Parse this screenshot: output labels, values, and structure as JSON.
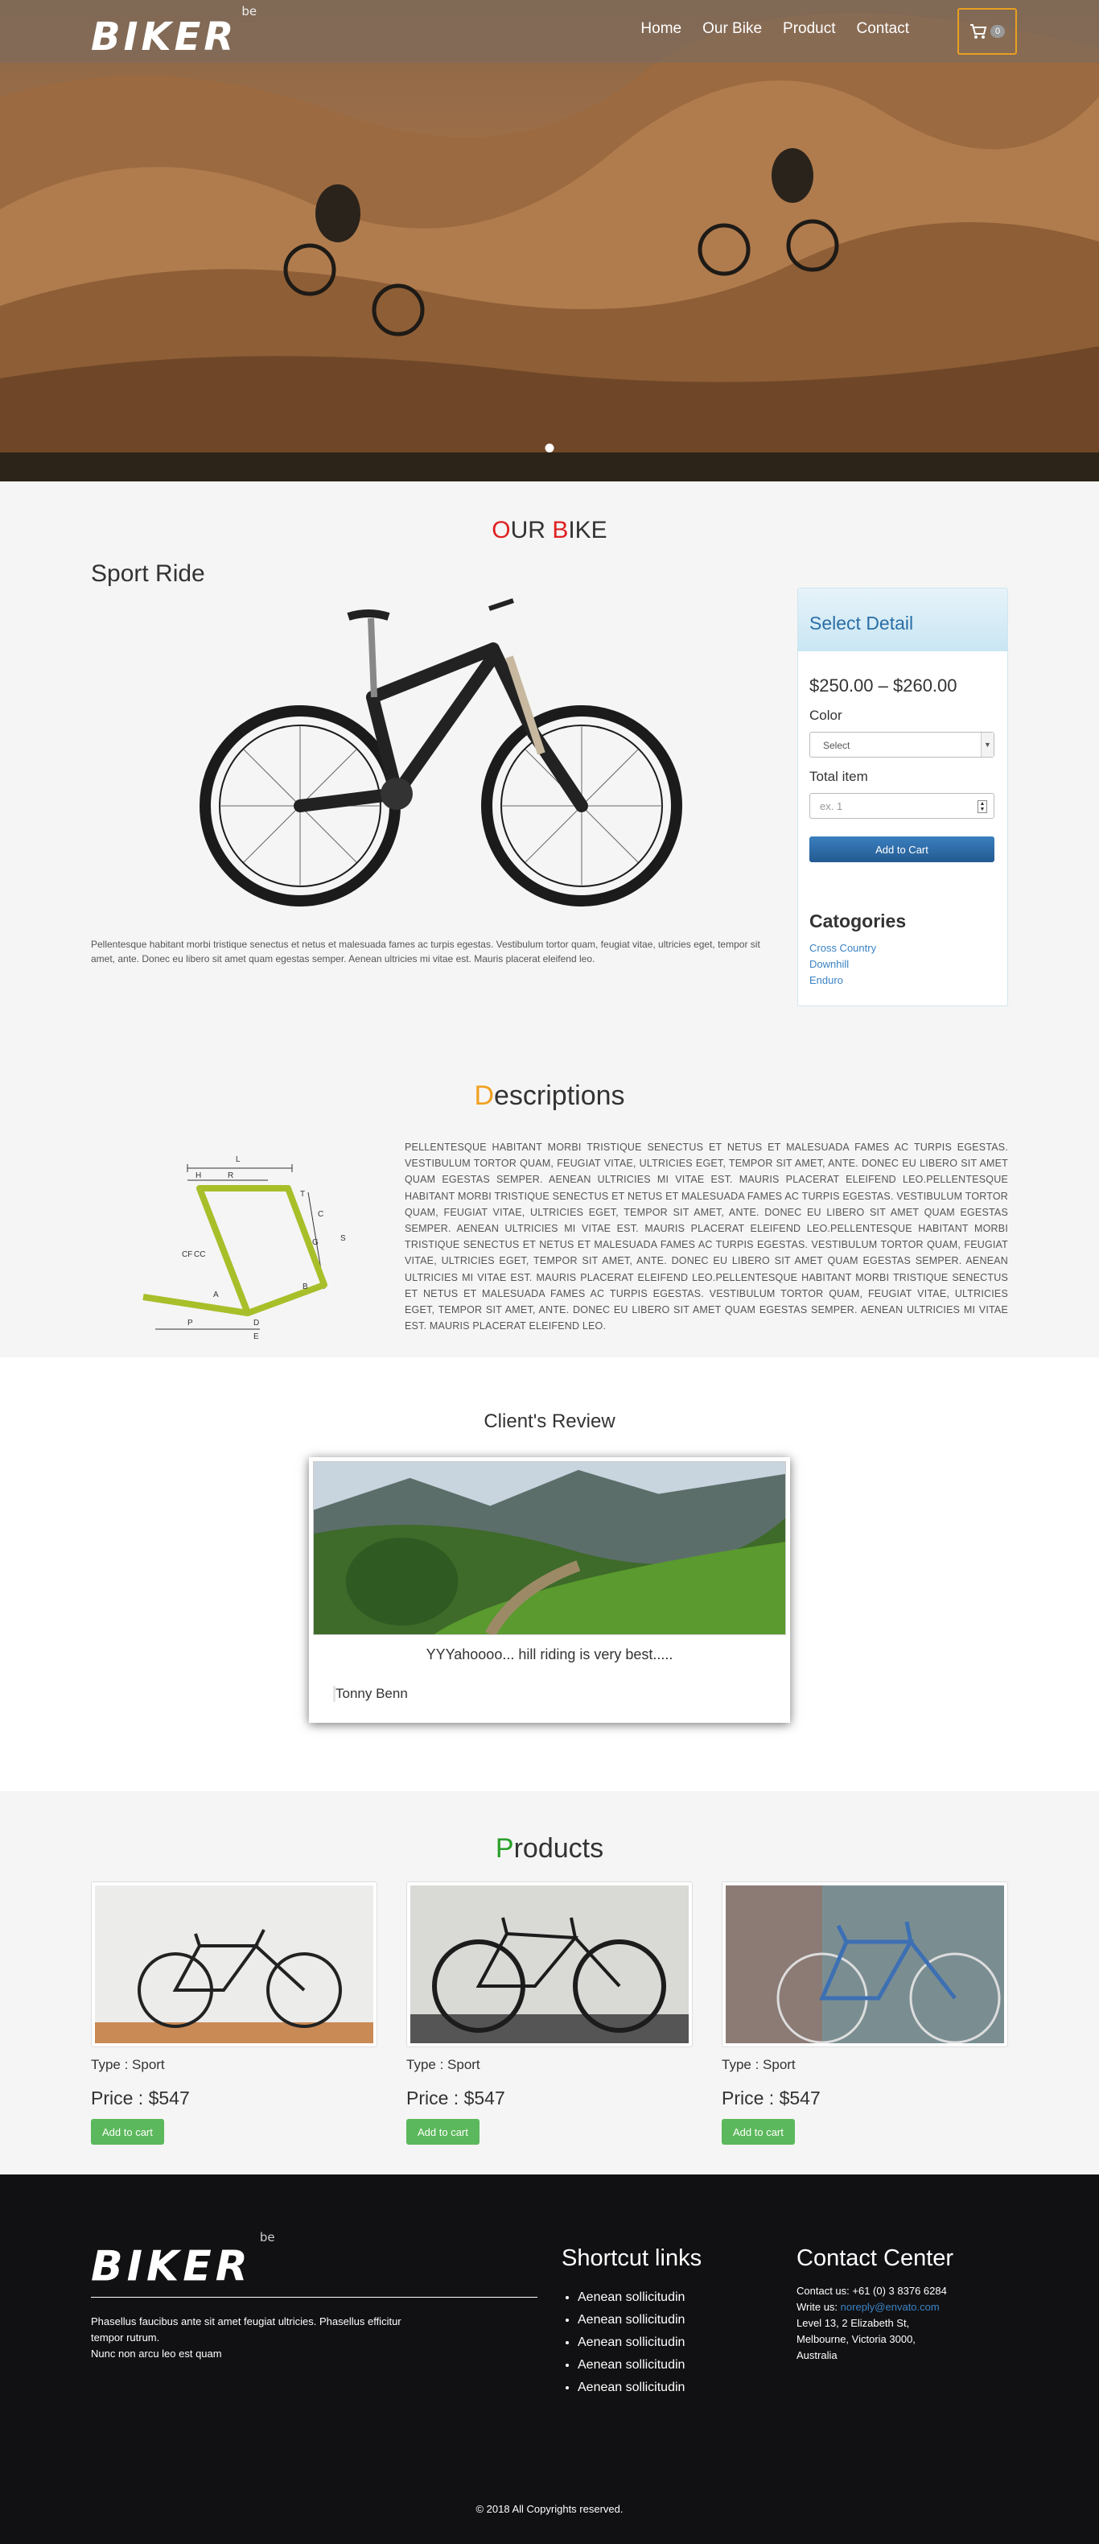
{
  "nav": {
    "logo": "BIKER",
    "logo_sup": "be",
    "links": [
      "Home",
      "Our Bike",
      "Product",
      "Contact"
    ],
    "cart_count": "0"
  },
  "our_bike": {
    "title_first": "O",
    "title_rest_1": "UR ",
    "title_b": "B",
    "title_rest_2": "IKE",
    "subtitle": "Sport Ride",
    "description": "Pellentesque habitant morbi tristique senectus et netus et malesuada fames ac turpis egestas. Vestibulum tortor quam, feugiat vitae, ultricies eget, tempor sit amet, ante. Donec eu libero sit amet quam egestas semper. Aenean ultricies mi vitae est. Mauris placerat eleifend leo."
  },
  "detail_panel": {
    "heading": "Select Detail",
    "price": "$250.00 – $260.00",
    "color_label": "Color",
    "color_selected": "Select",
    "total_label": "Total item",
    "total_placeholder": "ex. 1",
    "add_button": "Add to Cart",
    "categories_heading": "Catogories",
    "categories": [
      "Cross Country",
      "Downhill",
      "Enduro"
    ]
  },
  "descriptions": {
    "title_first": "D",
    "title_rest": "escriptions",
    "text": "PELLENTESQUE HABITANT MORBI TRISTIQUE SENECTUS ET NETUS ET MALESUADA FAMES AC TURPIS EGESTAS. VESTIBULUM TORTOR QUAM, FEUGIAT VITAE, ULTRICIES EGET, TEMPOR SIT AMET, ANTE. DONEC EU LIBERO SIT AMET QUAM EGESTAS SEMPER. AENEAN ULTRICIES MI VITAE EST. MAURIS PLACERAT ELEIFEND LEO.PELLENTESQUE HABITANT MORBI TRISTIQUE SENECTUS ET NETUS ET MALESUADA FAMES AC TURPIS EGESTAS. VESTIBULUM TORTOR QUAM, FEUGIAT VITAE, ULTRICIES EGET, TEMPOR SIT AMET, ANTE. DONEC EU LIBERO SIT AMET QUAM EGESTAS SEMPER. AENEAN ULTRICIES MI VITAE EST. MAURIS PLACERAT ELEIFEND LEO.PELLENTESQUE HABITANT MORBI TRISTIQUE SENECTUS ET NETUS ET MALESUADA FAMES AC TURPIS EGESTAS. VESTIBULUM TORTOR QUAM, FEUGIAT VITAE, ULTRICIES EGET, TEMPOR SIT AMET, ANTE. DONEC EU LIBERO SIT AMET QUAM EGESTAS SEMPER. AENEAN ULTRICIES MI VITAE EST. MAURIS PLACERAT ELEIFEND LEO.PELLENTESQUE HABITANT MORBI TRISTIQUE SENECTUS ET NETUS ET MALESUADA FAMES AC TURPIS EGESTAS. VESTIBULUM TORTOR QUAM, FEUGIAT VITAE, ULTRICIES EGET, TEMPOR SIT AMET, ANTE. DONEC EU LIBERO SIT AMET QUAM EGESTAS SEMPER. AENEAN ULTRICIES MI VITAE EST. MAURIS PLACERAT ELEIFEND LEO.",
    "frame_labels": [
      "L",
      "H",
      "R",
      "T",
      "C",
      "G",
      "S",
      "A",
      "B",
      "D",
      "P",
      "E",
      "CF",
      "CC"
    ]
  },
  "review": {
    "title": "Client's Review",
    "quote": "YYYahoooo... hill riding is very best.....",
    "author": "Tonny Benn"
  },
  "products": {
    "title_first": "P",
    "title_rest": "roducts",
    "items": [
      {
        "type": "Type : Sport",
        "price": "Price : $547",
        "button": "Add to cart"
      },
      {
        "type": "Type : Sport",
        "price": "Price : $547",
        "button": "Add to cart"
      },
      {
        "type": "Type : Sport",
        "price": "Price : $547",
        "button": "Add to cart"
      }
    ]
  },
  "footer": {
    "logo": "BIKER",
    "logo_sup": "be",
    "about_line1": "Phasellus faucibus ante sit amet feugiat ultricies. Phasellus efficitur tempor rutrum.",
    "about_line2": "Nunc non arcu leo est quam",
    "shortcut_heading": "Shortcut links",
    "shortcut_links": [
      "Aenean sollicitudin",
      "Aenean sollicitudin",
      "Aenean sollicitudin",
      "Aenean sollicitudin",
      "Aenean sollicitudin"
    ],
    "contact_heading": "Contact Center",
    "contact_phone": "Contact us: +61 (0) 3 8376 6284",
    "write_label": "Write us: ",
    "email": "noreply@envato.com",
    "address1": "Level 13, 2 Elizabeth St,",
    "address2": "Melbourne, Victoria 3000,",
    "address3": "Australia",
    "copyright": "© 2018 All Copyrights reserved."
  },
  "colors": {
    "accent_red": "#e02020",
    "accent_orange": "#f0a020",
    "accent_green": "#2aa02a",
    "panel_blue": "#2a6ea6",
    "button_green": "#5cb85c",
    "footer_bg": "#111113"
  },
  "icons": [
    "cart-icon",
    "chevron-down-icon",
    "spinner-icon"
  ]
}
